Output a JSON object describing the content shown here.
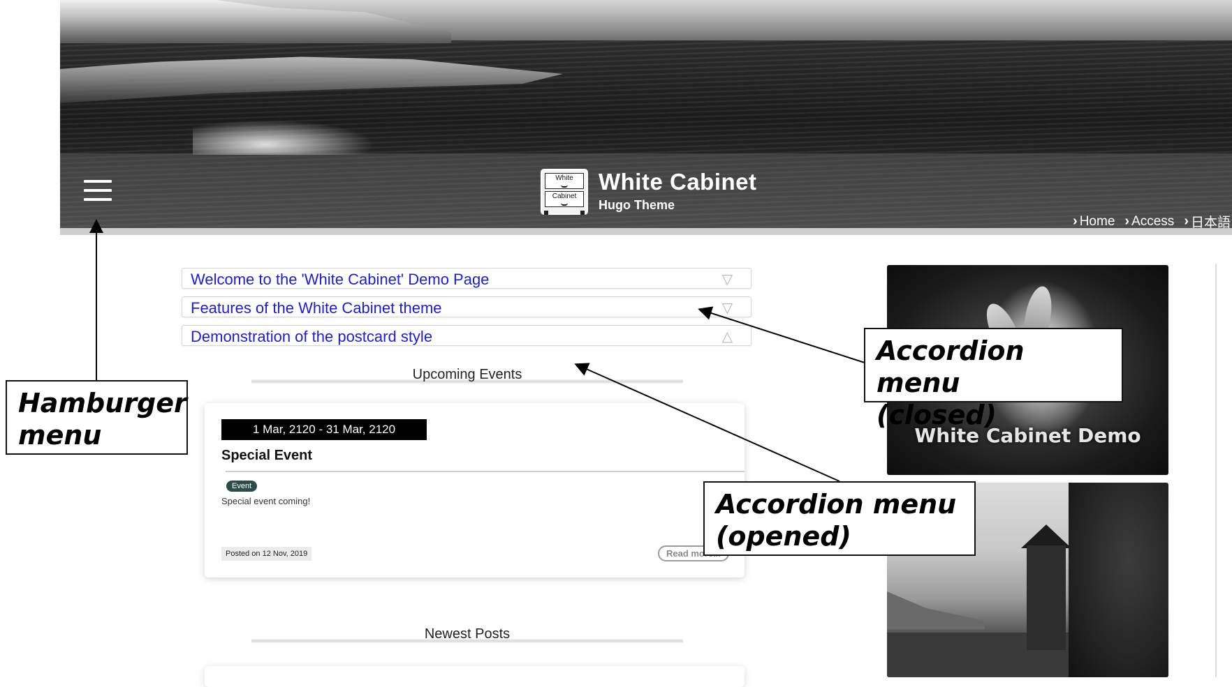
{
  "header": {
    "site_title": "White Cabinet",
    "site_subtitle": "Hugo Theme",
    "logo": {
      "drawer_top": "White",
      "drawer_bottom": "Cabinet"
    },
    "hamburger_icon": "hamburger-menu-icon",
    "nav": [
      {
        "label": "Home",
        "icon": "chevron-right-icon"
      },
      {
        "label": "Access",
        "icon": "chevron-right-icon"
      },
      {
        "label": "日本語",
        "icon": "chevron-right-icon"
      }
    ]
  },
  "accordion": [
    {
      "label": "Welcome to the 'White Cabinet' Demo Page",
      "toggle": "▽"
    },
    {
      "label": "Features of the White Cabinet theme",
      "toggle": "▽"
    },
    {
      "label": "Demonstration of the postcard style",
      "toggle": "△"
    }
  ],
  "sections": {
    "upcoming_events": "Upcoming Events",
    "newest_posts": "Newest Posts"
  },
  "event_card": {
    "date_range": "1 Mar, 2120 - 31 Mar, 2120",
    "title": "Special Event",
    "tag": "Event",
    "text": "Special event coming!",
    "posted": "Posted on 12 Nov, 2019",
    "read_more": "Read more..."
  },
  "sidebar": {
    "image1_caption": "White Cabinet Demo"
  },
  "annotations": {
    "hamburger": [
      "Hamburger",
      "menu"
    ],
    "accordion_closed": [
      "Accordion menu",
      "(closed)"
    ],
    "accordion_opened": [
      "Accordion menu",
      "(opened)"
    ]
  },
  "colors": {
    "link": "#1f1fbf",
    "tag_bg": "#2c4d47",
    "date_bar_bg": "#000000"
  }
}
